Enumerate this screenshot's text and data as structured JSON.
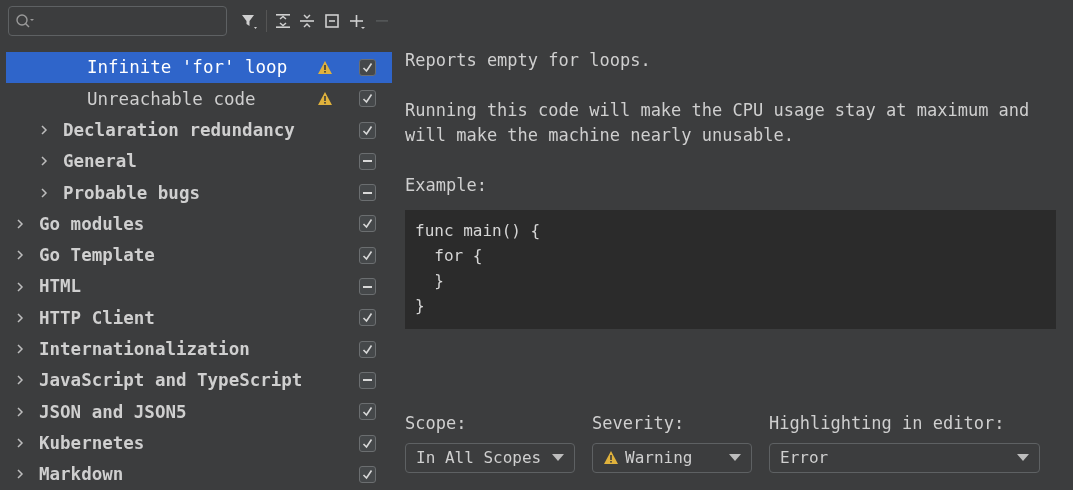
{
  "toolbar": {
    "buttons": [
      {
        "kind": "filter",
        "disabled": false
      },
      {
        "kind": "expand",
        "disabled": false
      },
      {
        "kind": "collapse",
        "disabled": false
      },
      {
        "kind": "reset",
        "disabled": false
      },
      {
        "kind": "add",
        "disabled": false
      },
      {
        "kind": "remove",
        "disabled": true
      }
    ]
  },
  "tree": [
    {
      "children": [
        {
          "children": [
            {
              "label": "Infinite 'for' loop",
              "selected": true,
              "warning": true,
              "checked": true,
              "partial": false
            },
            {
              "label": "Unreachable code",
              "selected": false,
              "warning": true,
              "checked": true,
              "partial": false
            }
          ]
        },
        {
          "label": "Declaration redundancy",
          "selected": false,
          "expanded": false,
          "checked": true,
          "partial": false
        },
        {
          "label": "General",
          "selected": false,
          "expanded": false,
          "checked": true,
          "partial": true
        },
        {
          "label": "Probable bugs",
          "selected": false,
          "expanded": false,
          "checked": true,
          "partial": true
        }
      ]
    },
    {
      "label": "Go modules",
      "selected": false,
      "expanded": false,
      "checked": true,
      "partial": false
    },
    {
      "label": "Go Template",
      "selected": false,
      "expanded": false,
      "checked": true,
      "partial": false
    },
    {
      "label": "HTML",
      "selected": false,
      "expanded": false,
      "checked": true,
      "partial": true
    },
    {
      "label": "HTTP Client",
      "selected": false,
      "expanded": false,
      "checked": true,
      "partial": false
    },
    {
      "label": "Internationalization",
      "selected": false,
      "expanded": false,
      "checked": true,
      "partial": false
    },
    {
      "label": "JavaScript and TypeScript",
      "selected": false,
      "expanded": false,
      "checked": true,
      "partial": true
    },
    {
      "label": "JSON and JSON5",
      "selected": false,
      "expanded": false,
      "checked": true,
      "partial": false
    },
    {
      "label": "Kubernetes",
      "selected": false,
      "expanded": false,
      "checked": true,
      "partial": false
    },
    {
      "label": "Markdown",
      "selected": false,
      "expanded": false,
      "checked": true,
      "partial": false
    }
  ],
  "description": {
    "paragraphs": [
      "Reports empty for loops.",
      "Running this code will make the CPU usage stay at maximum and will make the machine nearly unusable.",
      "Example:"
    ],
    "code": [
      "func main() {",
      "  for {",
      "  }",
      "}"
    ]
  },
  "options": [
    {
      "label": "Scope:",
      "value": "In All Scopes",
      "warning": false
    },
    {
      "label": "Severity:",
      "value": "Warning",
      "warning": true
    },
    {
      "label": "Highlighting in editor:",
      "value": "Error",
      "warning": false
    }
  ]
}
